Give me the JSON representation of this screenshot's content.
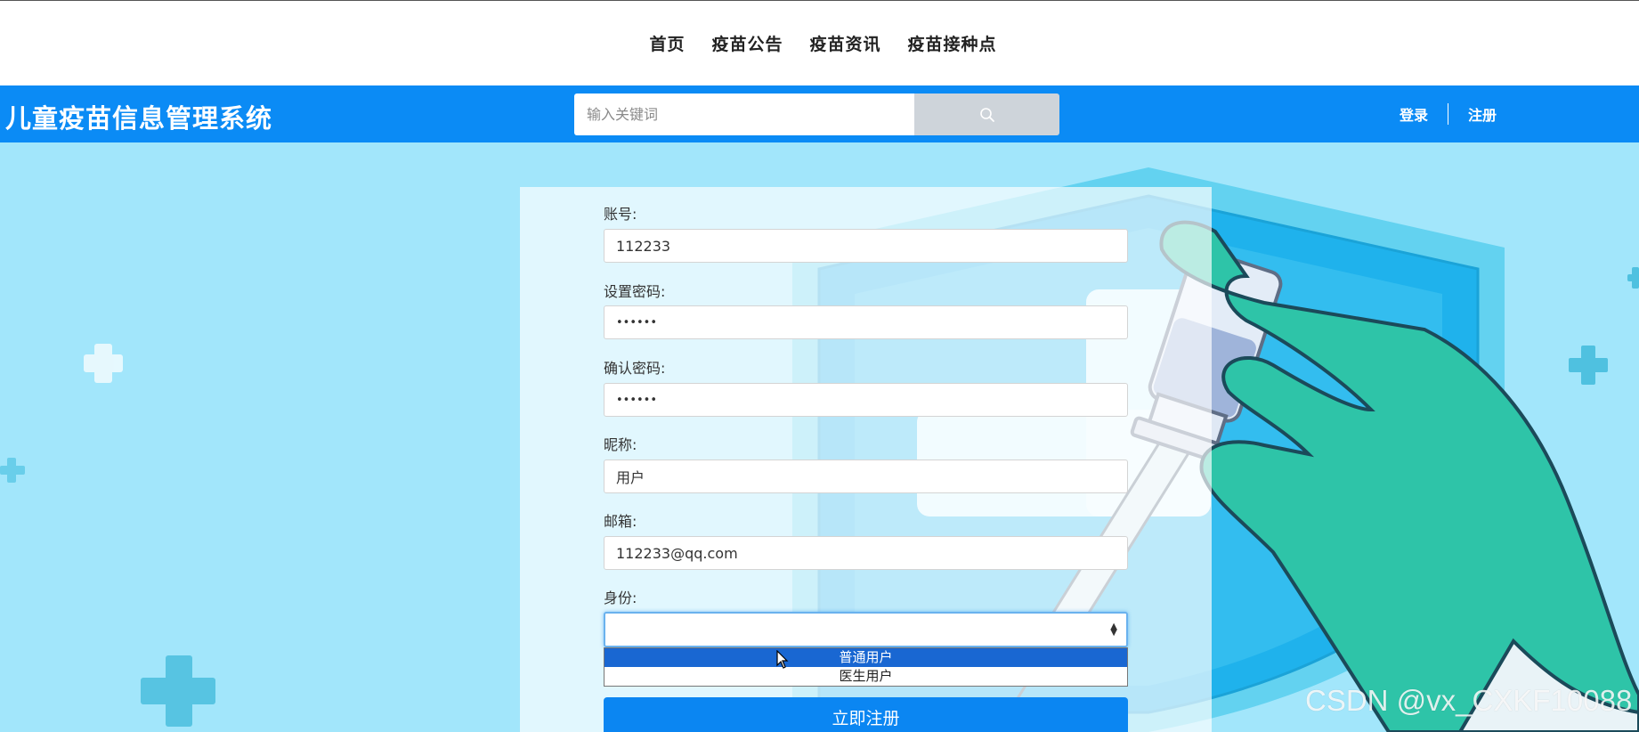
{
  "topnav": {
    "items": [
      "首页",
      "疫苗公告",
      "疫苗资讯",
      "疫苗接种点"
    ]
  },
  "header": {
    "title": "儿童疫苗信息管理系统",
    "search_placeholder": "输入关键词",
    "login": "登录",
    "register": "注册"
  },
  "form": {
    "account_label": "账号:",
    "account_value": "112233",
    "password_label": "设置密码:",
    "password_value": "••••••",
    "confirm_label": "确认密码:",
    "confirm_value": "••••••",
    "nickname_label": "昵称:",
    "nickname_value": "用户",
    "email_label": "邮箱:",
    "email_value": "112233@qq.com",
    "role_label": "身份:",
    "role_value": "",
    "role_options": [
      "普通用户",
      "医生用户"
    ],
    "role_highlighted": "普通用户",
    "submit": "立即注册"
  },
  "watermark": "CSDN @vx_CXKF10088",
  "colors": {
    "header_bg": "#0b8bf5",
    "hero_bg": "#a2e6fb",
    "submit_bg": "#0b86f2",
    "highlight": "#1967d2",
    "glove": "#2ec4a8"
  }
}
